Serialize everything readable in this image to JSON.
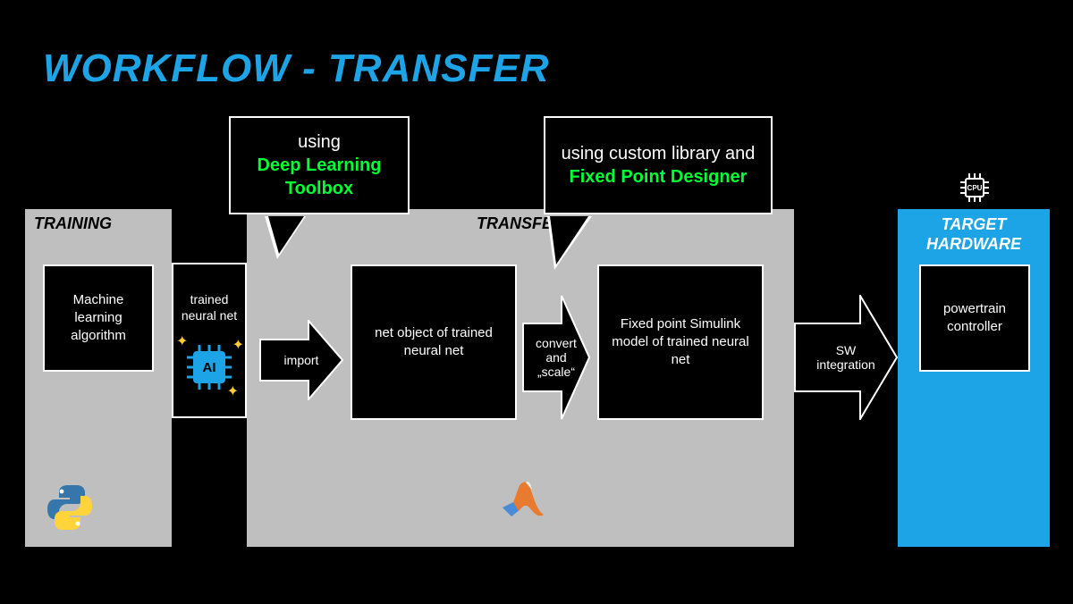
{
  "slide_title": "WORKFLOW - TRANSFER",
  "phases": {
    "training": {
      "label": "TRAINING"
    },
    "transfer": {
      "label": "TRANSFER"
    },
    "target": {
      "label": "TARGET HARDWARE"
    }
  },
  "nodes": {
    "ml_algo": "Machine learning algorithm",
    "trained_net": "trained neural net",
    "net_object": "net object of trained neural net",
    "fixed_model": "Fixed point Simulink model of trained neural net",
    "powertrain": "powertrain controller"
  },
  "arrows": {
    "import": "import",
    "convert": "convert and „scale“",
    "sw": "SW integration"
  },
  "callouts": {
    "c1_line1": "using",
    "c1_line2": "Deep Learning Toolbox",
    "c2_line1": "using custom library and",
    "c2_line2": "Fixed Point Designer"
  },
  "icons": {
    "python": "python-logo-icon",
    "matlab": "matlab-logo-icon",
    "cpu": "cpu-chip-icon",
    "ai_chip": "ai-chip-icon"
  }
}
